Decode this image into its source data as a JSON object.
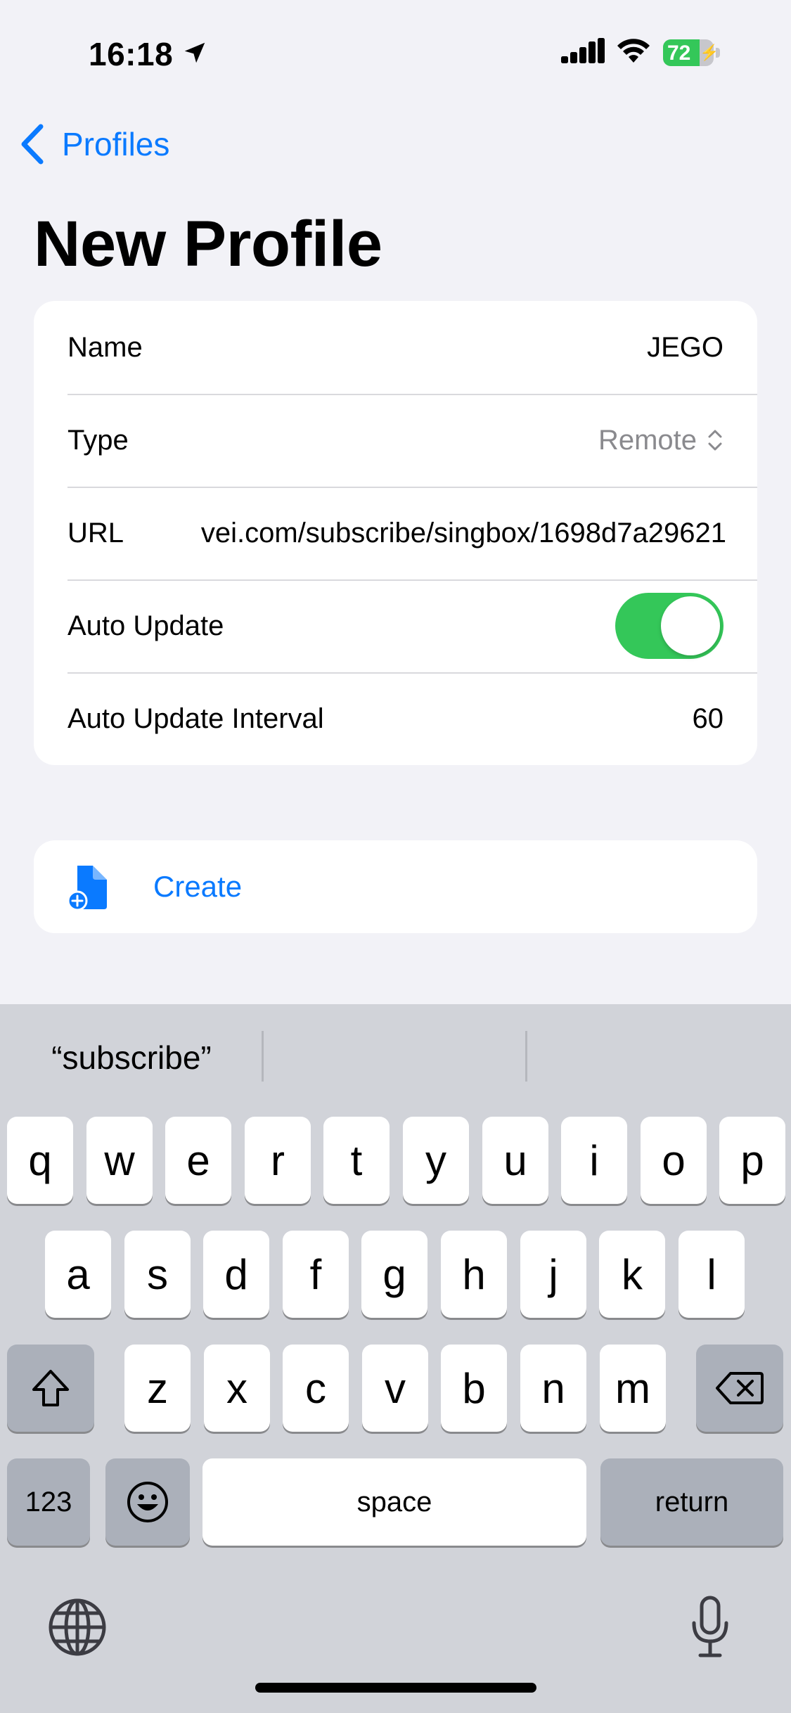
{
  "status_bar": {
    "time": "16:18",
    "battery": "72",
    "battery_level": 0.72
  },
  "nav": {
    "back_label": "Profiles"
  },
  "page_title": "New Profile",
  "form": {
    "name_label": "Name",
    "name_value": "JEGO",
    "type_label": "Type",
    "type_value": "Remote",
    "url_label": "URL",
    "url_value": "vei.com/subscribe/singbox/1698d7a29621",
    "auto_update_label": "Auto Update",
    "auto_update_on": true,
    "interval_label": "Auto Update Interval",
    "interval_value": "60"
  },
  "create_label": "Create",
  "keyboard": {
    "suggestions": [
      "“subscribe”",
      "",
      ""
    ],
    "row1": [
      "q",
      "w",
      "e",
      "r",
      "t",
      "y",
      "u",
      "i",
      "o",
      "p"
    ],
    "row2": [
      "a",
      "s",
      "d",
      "f",
      "g",
      "h",
      "j",
      "k",
      "l"
    ],
    "row3": [
      "z",
      "x",
      "c",
      "v",
      "b",
      "n",
      "m"
    ],
    "numbers_label": "123",
    "space_label": "space",
    "return_label": "return"
  },
  "colors": {
    "accent": "#0A7AFF",
    "toggle_on": "#34C759",
    "battery": "#34C759"
  }
}
